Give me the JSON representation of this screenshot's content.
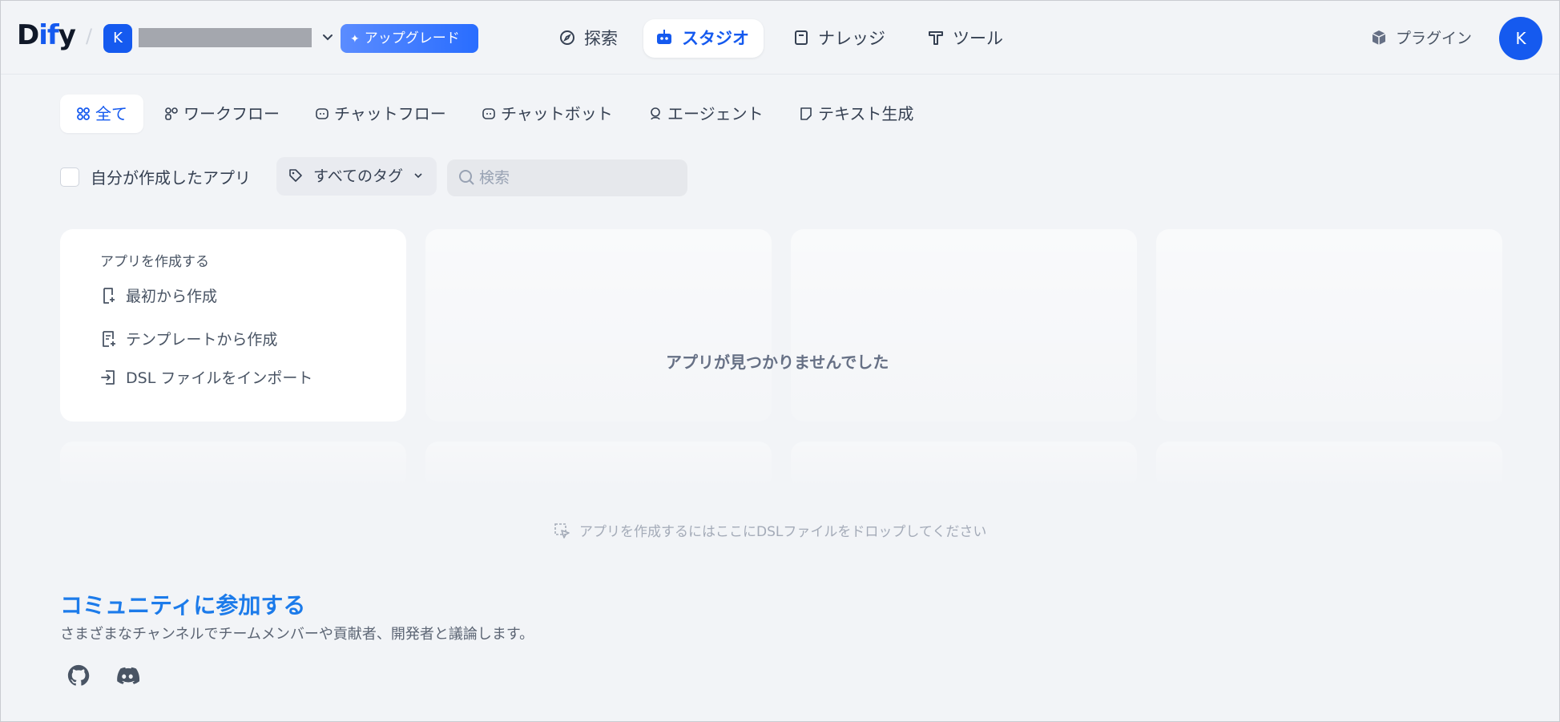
{
  "header": {
    "logo_prefix": "D",
    "logo_highlight": "if",
    "logo_suffix": "y",
    "separator": "/",
    "workspace_initial": "K",
    "upgrade_label": "アップグレード",
    "nav": [
      {
        "label": "探索",
        "icon": "compass-icon"
      },
      {
        "label": "スタジオ",
        "icon": "robot-icon"
      },
      {
        "label": "ナレッジ",
        "icon": "book-icon"
      },
      {
        "label": "ツール",
        "icon": "hammer-icon"
      }
    ],
    "plugin_label": "プラグイン",
    "user_initial": "K"
  },
  "tabs": [
    {
      "label": "全て",
      "icon": "grid-icon"
    },
    {
      "label": "ワークフロー",
      "icon": "workflow-icon"
    },
    {
      "label": "チャットフロー",
      "icon": "chatflow-icon"
    },
    {
      "label": "チャットボット",
      "icon": "chatbot-icon"
    },
    {
      "label": "エージェント",
      "icon": "agent-icon"
    },
    {
      "label": "テキスト生成",
      "icon": "text-generator-icon"
    }
  ],
  "filters": {
    "mine_label": "自分が作成したアプリ",
    "tag_label": "すべてのタグ",
    "search_placeholder": "検索"
  },
  "create_card": {
    "title": "アプリを作成する",
    "items": [
      {
        "label": "最初から作成",
        "icon": "file-plus-icon"
      },
      {
        "label": "テンプレートから作成",
        "icon": "file-template-icon"
      },
      {
        "label": "DSL ファイルをインポート",
        "icon": "import-icon"
      }
    ]
  },
  "empty_message": "アプリが見つかりませんでした",
  "dsl_drop_hint": "アプリを作成するにはここにDSLファイルをドロップしてください",
  "community": {
    "title": "コミュニティに参加する",
    "description": "さまざまなチャンネルでチームメンバーや貢献者、開発者と議論します。"
  },
  "colors": {
    "accent": "#155aef",
    "community_title": "#1c7bea",
    "background": "#f2f4f7"
  }
}
